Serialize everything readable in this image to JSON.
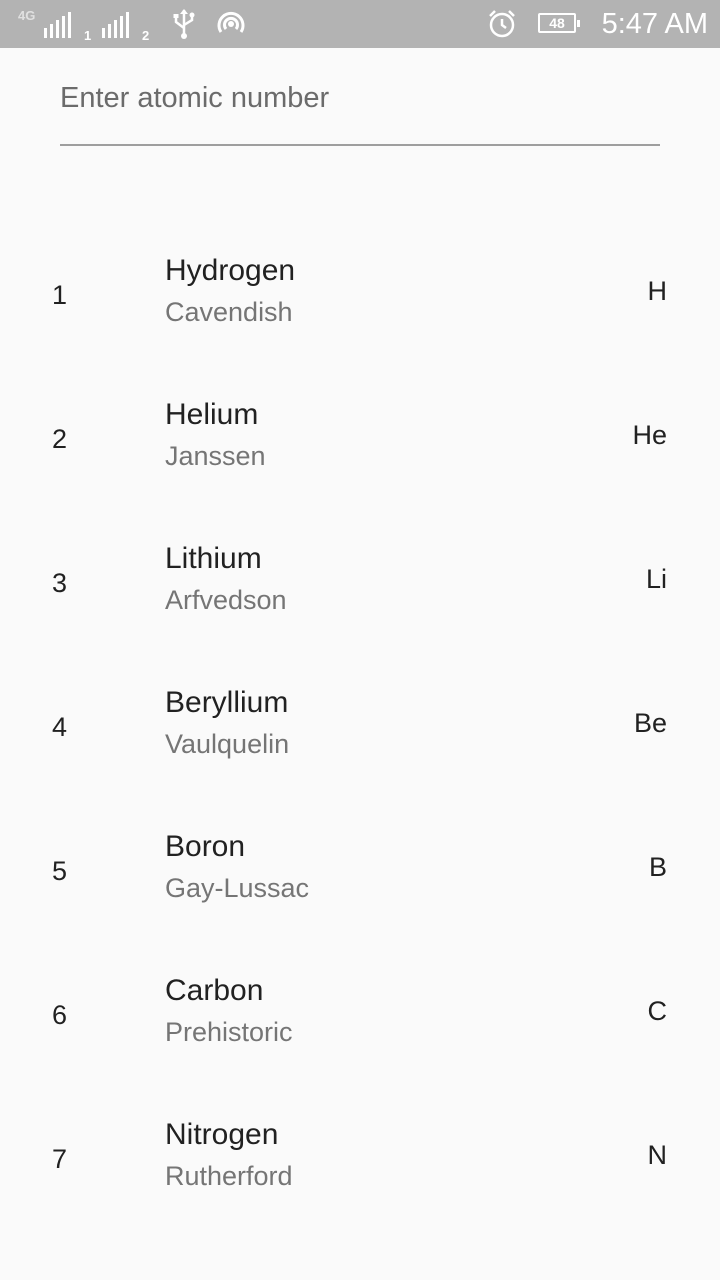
{
  "status_bar": {
    "network_type": "4G",
    "sim1": "1",
    "sim2": "2",
    "battery": "48",
    "time": "5:47 AM",
    "icons": [
      "signal-sim1-icon",
      "signal-sim2-icon",
      "usb-icon",
      "hotspot-icon",
      "alarm-icon",
      "battery-icon"
    ]
  },
  "search": {
    "placeholder": "Enter atomic number",
    "value": ""
  },
  "elements": [
    {
      "number": "1",
      "name": "Hydrogen",
      "discoverer": "Cavendish",
      "symbol": "H"
    },
    {
      "number": "2",
      "name": "Helium",
      "discoverer": "Janssen",
      "symbol": "He"
    },
    {
      "number": "3",
      "name": "Lithium",
      "discoverer": "Arfvedson",
      "symbol": "Li"
    },
    {
      "number": "4",
      "name": "Beryllium",
      "discoverer": "Vaulquelin",
      "symbol": "Be"
    },
    {
      "number": "5",
      "name": "Boron",
      "discoverer": "Gay-Lussac",
      "symbol": "B"
    },
    {
      "number": "6",
      "name": "Carbon",
      "discoverer": "Prehistoric",
      "symbol": "C"
    },
    {
      "number": "7",
      "name": "Nitrogen",
      "discoverer": "Rutherford",
      "symbol": "N"
    }
  ],
  "colors": {
    "status_bar_bg": "#b3b3b3",
    "background": "#fafafa",
    "primary_text": "#212121",
    "secondary_text": "#757575",
    "underline": "#9e9e9e"
  }
}
